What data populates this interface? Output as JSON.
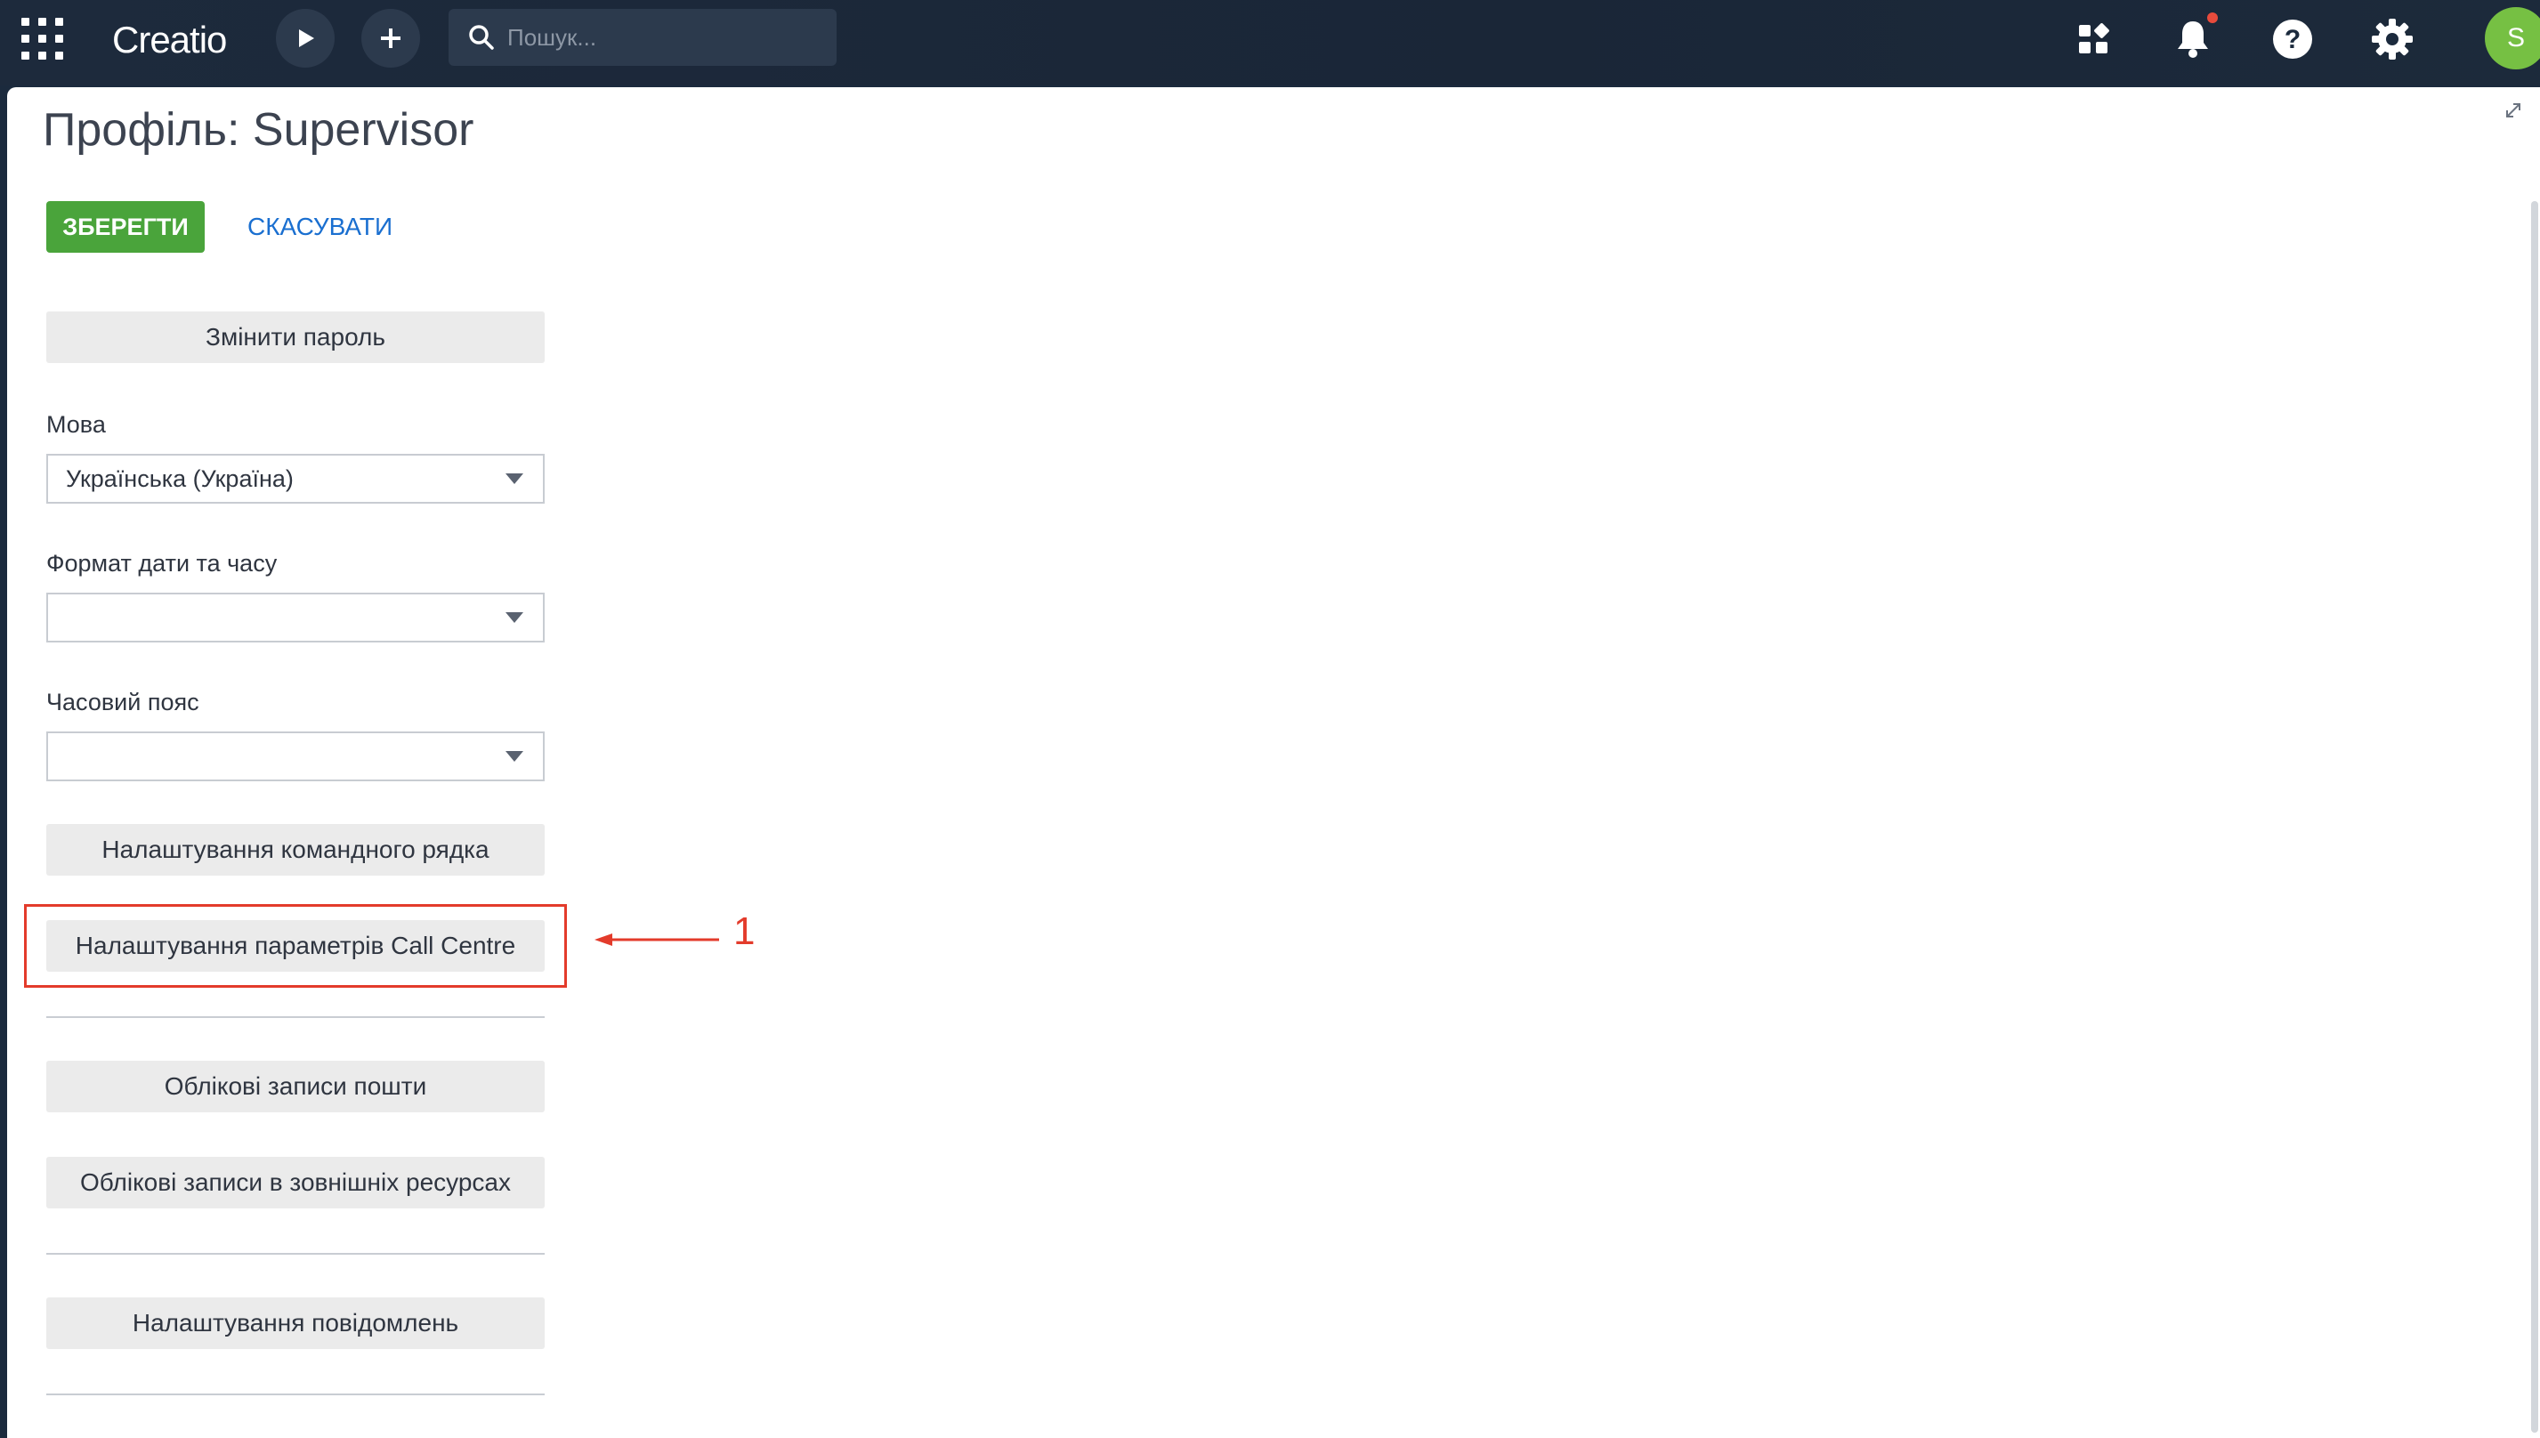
{
  "topbar": {
    "logo": "Creatio",
    "search_placeholder": "Пошук...",
    "avatar_initial": "S"
  },
  "page": {
    "title": "Профіль: Supervisor",
    "save_label": "ЗБЕРЕГТИ",
    "cancel_label": "СКАСУВАТИ",
    "change_password_label": "Змінити пароль",
    "language": {
      "label": "Мова",
      "value": "Українська (Україна)"
    },
    "datetime_format": {
      "label": "Формат дати та часу",
      "value": ""
    },
    "timezone": {
      "label": "Часовий пояс",
      "value": ""
    },
    "command_line_settings_label": "Налаштування командного рядка",
    "call_centre_settings_label": "Налаштування параметрів Call Centre",
    "mail_accounts_label": "Облікові записи пошти",
    "external_accounts_label": "Облікові записи в зовнішніх ресурсах",
    "notification_settings_label": "Налаштування повідомлень"
  },
  "annotation": {
    "number": "1"
  },
  "colors": {
    "topbar": "#1b2a3d",
    "save": "#4aa43b",
    "cancel": "#1a6fd0",
    "highlight": "#e33b2b",
    "avatar": "#76c043"
  }
}
